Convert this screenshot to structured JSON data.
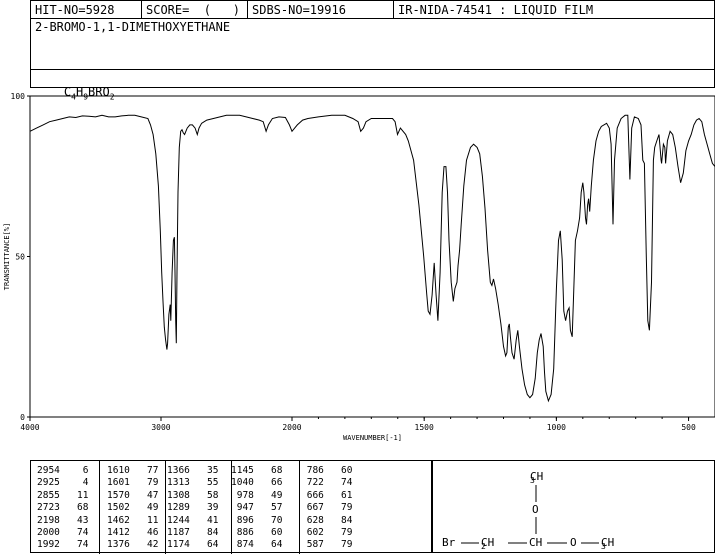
{
  "header": {
    "hit_no": "HIT-NO=5928",
    "score": "SCORE=  (   )",
    "sdbs_no": "SDBS-NO=19916",
    "ir_info": "IR-NIDA-74541 : LIQUID FILM"
  },
  "compound_name": "2-BROMO-1,1-DIMETHOXYETHANE",
  "formula": {
    "c": "C",
    "c_n": "4",
    "h": "H",
    "h_n": "9",
    "rest": "BRO",
    "o_n": "2"
  },
  "chart_data": {
    "type": "line",
    "xlabel": "WAVENUMBER[-1]",
    "ylabel": "TRANSMITTANCE[%]",
    "xlim": [
      4000,
      400
    ],
    "ylim": [
      0,
      100
    ],
    "x_ticks": [
      4000,
      3000,
      2000,
      1500,
      1000,
      500
    ],
    "x_tick_labels": [
      "4000",
      "3000",
      "2000",
      "1500",
      "1000",
      "500"
    ],
    "y_ticks": [
      0,
      50,
      100
    ],
    "y_tick_labels": [
      "0",
      "50",
      "100"
    ],
    "series": [
      {
        "points": [
          [
            4000,
            89
          ],
          [
            3950,
            90
          ],
          [
            3900,
            91
          ],
          [
            3850,
            92
          ],
          [
            3800,
            92.5
          ],
          [
            3750,
            93
          ],
          [
            3700,
            93.5
          ],
          [
            3650,
            93.3
          ],
          [
            3600,
            93.8
          ],
          [
            3550,
            93.7
          ],
          [
            3500,
            93.5
          ],
          [
            3450,
            94
          ],
          [
            3400,
            93.5
          ],
          [
            3350,
            93.5
          ],
          [
            3300,
            93.8
          ],
          [
            3250,
            94
          ],
          [
            3200,
            94
          ],
          [
            3150,
            93.5
          ],
          [
            3100,
            93
          ],
          [
            3080,
            91
          ],
          [
            3060,
            88
          ],
          [
            3040,
            82
          ],
          [
            3020,
            72
          ],
          [
            3005,
            58
          ],
          [
            2995,
            45
          ],
          [
            2985,
            36
          ],
          [
            2975,
            28
          ],
          [
            2965,
            24
          ],
          [
            2955,
            21
          ],
          [
            2950,
            23
          ],
          [
            2940,
            32
          ],
          [
            2930,
            35
          ],
          [
            2925,
            30
          ],
          [
            2915,
            45
          ],
          [
            2905,
            55
          ],
          [
            2898,
            56
          ],
          [
            2893,
            45
          ],
          [
            2888,
            30
          ],
          [
            2883,
            23
          ],
          [
            2878,
            45
          ],
          [
            2870,
            70
          ],
          [
            2860,
            84
          ],
          [
            2850,
            89
          ],
          [
            2840,
            89.5
          ],
          [
            2830,
            88.5
          ],
          [
            2820,
            88
          ],
          [
            2800,
            90
          ],
          [
            2780,
            91
          ],
          [
            2760,
            91
          ],
          [
            2740,
            90
          ],
          [
            2723,
            88
          ],
          [
            2710,
            90
          ],
          [
            2690,
            91.5
          ],
          [
            2670,
            92
          ],
          [
            2650,
            92.5
          ],
          [
            2600,
            93
          ],
          [
            2550,
            93.5
          ],
          [
            2500,
            94
          ],
          [
            2450,
            94
          ],
          [
            2400,
            94
          ],
          [
            2350,
            93.5
          ],
          [
            2300,
            93
          ],
          [
            2250,
            92.5
          ],
          [
            2220,
            92
          ],
          [
            2198,
            89
          ],
          [
            2180,
            91
          ],
          [
            2150,
            93
          ],
          [
            2100,
            93.5
          ],
          [
            2050,
            93.3
          ],
          [
            2020,
            91
          ],
          [
            2000,
            89
          ],
          [
            1980,
            91
          ],
          [
            1960,
            92.5
          ],
          [
            1940,
            93
          ],
          [
            1900,
            93.5
          ],
          [
            1850,
            94
          ],
          [
            1800,
            94
          ],
          [
            1770,
            93
          ],
          [
            1750,
            92
          ],
          [
            1740,
            89
          ],
          [
            1730,
            90
          ],
          [
            1720,
            92
          ],
          [
            1700,
            93
          ],
          [
            1650,
            93
          ],
          [
            1620,
            93
          ],
          [
            1610,
            92
          ],
          [
            1601,
            88
          ],
          [
            1590,
            90
          ],
          [
            1570,
            88
          ],
          [
            1560,
            86
          ],
          [
            1540,
            80
          ],
          [
            1520,
            66
          ],
          [
            1502,
            50
          ],
          [
            1490,
            38
          ],
          [
            1485,
            33
          ],
          [
            1478,
            32
          ],
          [
            1470,
            38
          ],
          [
            1462,
            48
          ],
          [
            1455,
            38
          ],
          [
            1448,
            30
          ],
          [
            1440,
            45
          ],
          [
            1432,
            70
          ],
          [
            1425,
            78
          ],
          [
            1418,
            78
          ],
          [
            1412,
            70
          ],
          [
            1406,
            55
          ],
          [
            1398,
            42
          ],
          [
            1390,
            36
          ],
          [
            1384,
            40
          ],
          [
            1376,
            42
          ],
          [
            1372,
            47
          ],
          [
            1366,
            52
          ],
          [
            1360,
            60
          ],
          [
            1350,
            72
          ],
          [
            1340,
            80
          ],
          [
            1325,
            84
          ],
          [
            1313,
            85
          ],
          [
            1300,
            84
          ],
          [
            1290,
            82
          ],
          [
            1280,
            75
          ],
          [
            1270,
            65
          ],
          [
            1260,
            52
          ],
          [
            1250,
            42
          ],
          [
            1244,
            41
          ],
          [
            1238,
            43
          ],
          [
            1230,
            40
          ],
          [
            1220,
            35
          ],
          [
            1210,
            29
          ],
          [
            1200,
            22
          ],
          [
            1192,
            19
          ],
          [
            1187,
            20
          ],
          [
            1182,
            28
          ],
          [
            1178,
            29
          ],
          [
            1174,
            25
          ],
          [
            1168,
            20
          ],
          [
            1160,
            18
          ],
          [
            1152,
            24
          ],
          [
            1146,
            27
          ],
          [
            1140,
            22
          ],
          [
            1130,
            15
          ],
          [
            1120,
            10
          ],
          [
            1110,
            7
          ],
          [
            1100,
            6
          ],
          [
            1090,
            7
          ],
          [
            1080,
            12
          ],
          [
            1072,
            20
          ],
          [
            1065,
            24
          ],
          [
            1058,
            26
          ],
          [
            1050,
            22
          ],
          [
            1045,
            14
          ],
          [
            1040,
            8
          ],
          [
            1030,
            5
          ],
          [
            1020,
            7
          ],
          [
            1010,
            15
          ],
          [
            1000,
            40
          ],
          [
            992,
            55
          ],
          [
            985,
            58
          ],
          [
            978,
            49
          ],
          [
            972,
            33
          ],
          [
            965,
            30
          ],
          [
            958,
            33
          ],
          [
            952,
            34
          ],
          [
            947,
            27
          ],
          [
            940,
            25
          ],
          [
            935,
            38
          ],
          [
            928,
            55
          ],
          [
            920,
            58
          ],
          [
            912,
            62
          ],
          [
            906,
            70
          ],
          [
            900,
            73
          ],
          [
            896,
            70
          ],
          [
            890,
            62
          ],
          [
            886,
            60
          ],
          [
            882,
            66
          ],
          [
            878,
            68
          ],
          [
            874,
            64
          ],
          [
            868,
            72
          ],
          [
            860,
            80
          ],
          [
            850,
            86
          ],
          [
            840,
            89
          ],
          [
            830,
            90.5
          ],
          [
            810,
            91.5
          ],
          [
            800,
            90
          ],
          [
            793,
            85
          ],
          [
            786,
            60
          ],
          [
            780,
            80
          ],
          [
            770,
            90
          ],
          [
            755,
            93
          ],
          [
            740,
            94
          ],
          [
            730,
            94
          ],
          [
            722,
            74
          ],
          [
            715,
            90
          ],
          [
            705,
            93.5
          ],
          [
            690,
            93
          ],
          [
            680,
            91
          ],
          [
            673,
            80
          ],
          [
            667,
            79
          ],
          [
            660,
            50
          ],
          [
            654,
            30
          ],
          [
            648,
            27
          ],
          [
            640,
            42
          ],
          [
            633,
            80
          ],
          [
            628,
            84
          ],
          [
            620,
            86
          ],
          [
            612,
            88
          ],
          [
            604,
            80
          ],
          [
            602,
            79
          ],
          [
            595,
            85
          ],
          [
            590,
            84
          ],
          [
            587,
            79
          ],
          [
            580,
            86
          ],
          [
            570,
            89
          ],
          [
            560,
            88
          ],
          [
            550,
            84
          ],
          [
            540,
            78
          ],
          [
            530,
            73
          ],
          [
            520,
            76
          ],
          [
            510,
            83
          ],
          [
            500,
            86
          ],
          [
            490,
            88
          ],
          [
            480,
            91
          ],
          [
            470,
            92.5
          ],
          [
            460,
            93
          ],
          [
            450,
            92
          ],
          [
            440,
            88
          ],
          [
            430,
            85
          ],
          [
            420,
            82
          ],
          [
            410,
            79
          ],
          [
            400,
            78
          ]
        ]
      }
    ]
  },
  "peak_table": [
    [
      "2954",
      "6",
      "1610",
      "77",
      "1366",
      "35",
      "1145",
      "68",
      "786",
      "60"
    ],
    [
      "2925",
      "4",
      "1601",
      "79",
      "1313",
      "55",
      "1040",
      "66",
      "722",
      "74"
    ],
    [
      "2855",
      "11",
      "1570",
      "47",
      "1308",
      "58",
      "978",
      "49",
      "666",
      "61"
    ],
    [
      "2723",
      "68",
      "1502",
      "49",
      "1289",
      "39",
      "947",
      "57",
      "667",
      "79"
    ],
    [
      "2198",
      "43",
      "1462",
      "11",
      "1244",
      "41",
      "896",
      "70",
      "628",
      "84"
    ],
    [
      "2000",
      "74",
      "1412",
      "46",
      "1187",
      "84",
      "886",
      "60",
      "602",
      "79"
    ],
    [
      "1992",
      "74",
      "1376",
      "42",
      "1174",
      "64",
      "874",
      "64",
      "587",
      "79"
    ]
  ],
  "structure": {
    "ch3_top": {
      "c": "CH",
      "n": "3"
    },
    "o_top": "O",
    "br": "Br",
    "ch2": {
      "c": "CH",
      "n": "2"
    },
    "ch": "CH",
    "o_right": "O",
    "ch3_right": {
      "c": "CH",
      "n": "3"
    }
  }
}
